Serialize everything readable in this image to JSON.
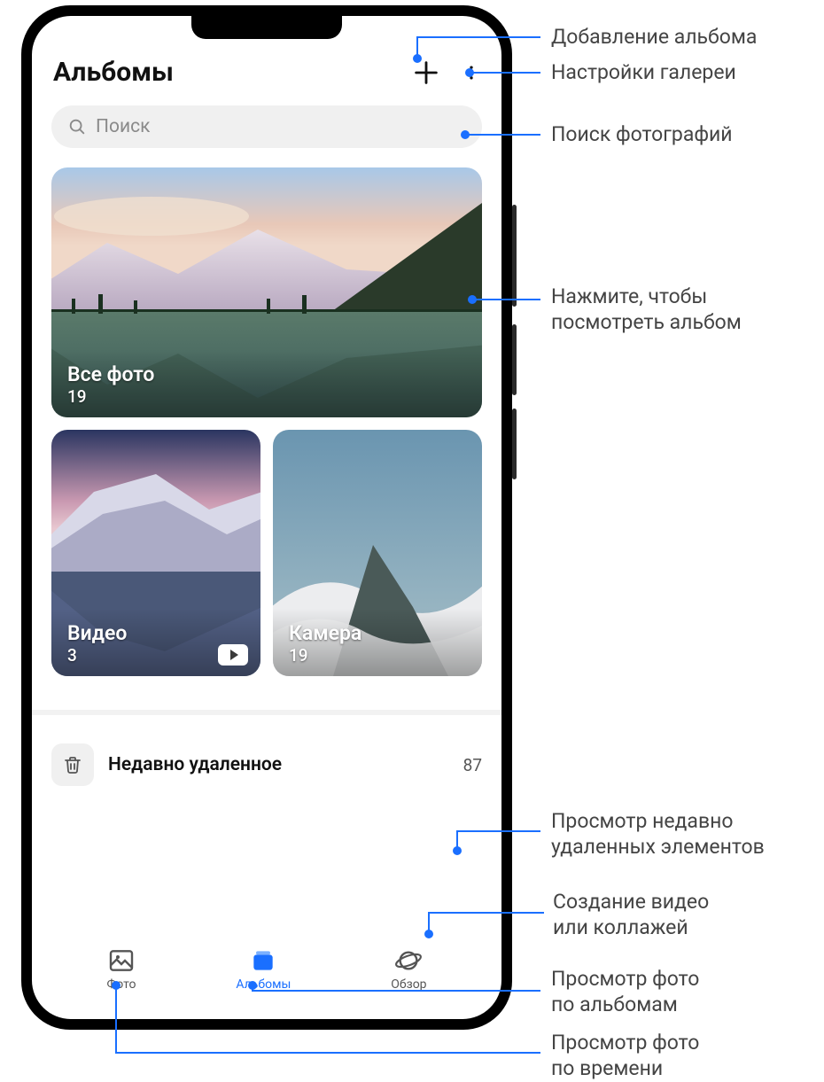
{
  "header": {
    "title": "Альбомы"
  },
  "icons": {
    "add": "plus-icon",
    "more": "more-vertical-icon",
    "search": "search-icon",
    "trash": "trash-icon",
    "video": "video-icon",
    "photos_tab": "photo-icon",
    "albums_tab": "albums-icon",
    "discover_tab": "planet-icon"
  },
  "search": {
    "placeholder": "Поиск"
  },
  "albums": [
    {
      "id": "all",
      "title": "Все фото",
      "count": "19",
      "kind": "main"
    },
    {
      "id": "videos",
      "title": "Видео",
      "count": "3",
      "kind": "video"
    },
    {
      "id": "camera",
      "title": "Камера",
      "count": "19",
      "kind": "camera"
    }
  ],
  "deleted": {
    "label": "Недавно удаленное",
    "count": "87"
  },
  "nav": {
    "photos": "Фото",
    "albums": "Альбомы",
    "discover": "Обзор",
    "active": "albums"
  },
  "callouts": {
    "add_album": "Добавление альбома",
    "settings": "Настройки галереи",
    "search": "Поиск фотографий",
    "open_album": "Нажмите, чтобы\nпосмотреть альбом",
    "deleted": "Просмотр недавно\nудаленных элементов",
    "create": "Создание видео\nили коллажей",
    "by_album": "Просмотр фото\nпо альбомам",
    "by_time": "Просмотр фото\nпо времени"
  },
  "colors": {
    "accent": "#1a6fff",
    "callout_line": "#1a6fff"
  }
}
